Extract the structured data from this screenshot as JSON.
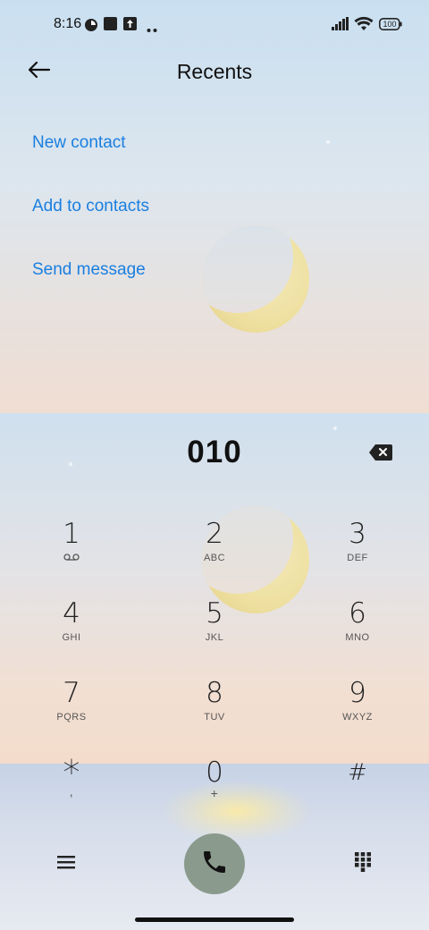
{
  "status_bar": {
    "time": "8:16",
    "battery": "100",
    "icons": [
      "notification-app-icon",
      "square-notification-icon",
      "upload-notification-icon",
      "more-dots-icon",
      "signal-icon",
      "wifi-icon",
      "battery-icon"
    ]
  },
  "header": {
    "title": "Recents",
    "back_icon": "back-arrow-icon"
  },
  "actions": [
    {
      "label": "New contact"
    },
    {
      "label": "Add to contacts"
    },
    {
      "label": "Send message"
    }
  ],
  "dialer": {
    "number": "010",
    "backspace_icon": "backspace-icon",
    "keys": [
      {
        "digit": "1",
        "sub": ""
      },
      {
        "digit": "2",
        "sub": "ABC"
      },
      {
        "digit": "3",
        "sub": "DEF"
      },
      {
        "digit": "4",
        "sub": "GHI"
      },
      {
        "digit": "5",
        "sub": "JKL"
      },
      {
        "digit": "6",
        "sub": "MNO"
      },
      {
        "digit": "7",
        "sub": "PQRS"
      },
      {
        "digit": "8",
        "sub": "TUV"
      },
      {
        "digit": "9",
        "sub": "WXYZ"
      },
      {
        "digit": "*",
        "sub": ","
      },
      {
        "digit": "0",
        "sub": "+"
      },
      {
        "digit": "#",
        "sub": ""
      }
    ]
  },
  "bottom_bar": {
    "menu_icon": "menu-icon",
    "call_icon": "phone-icon",
    "keypad_icon": "dialpad-icon"
  },
  "colors": {
    "accent": "#1a7fe0",
    "call_button": "#8a9a8c"
  }
}
